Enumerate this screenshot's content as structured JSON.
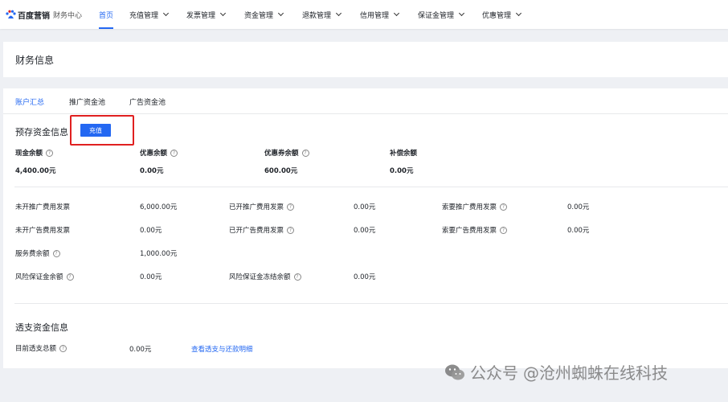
{
  "header": {
    "brand": "百度营销",
    "subtitle": "财务中心",
    "nav": [
      {
        "label": "首页",
        "active": true,
        "dropdown": false
      },
      {
        "label": "充值管理",
        "dropdown": true
      },
      {
        "label": "发票管理",
        "dropdown": true
      },
      {
        "label": "资金管理",
        "dropdown": true
      },
      {
        "label": "退款管理",
        "dropdown": true
      },
      {
        "label": "信用管理",
        "dropdown": true
      },
      {
        "label": "保证金管理",
        "dropdown": true
      },
      {
        "label": "优惠管理",
        "dropdown": true
      }
    ]
  },
  "page": {
    "title": "财务信息"
  },
  "tabs": [
    "账户汇总",
    "推广资金池",
    "广告资金池"
  ],
  "prepaid": {
    "title": "预存资金信息",
    "recharge_label": "充值",
    "balances": [
      {
        "label": "现金余额",
        "value": "4,400.00元"
      },
      {
        "label": "优惠余额",
        "value": "0.00元"
      },
      {
        "label": "优惠券余额",
        "value": "600.00元"
      },
      {
        "label": "补偿余额",
        "value": "0.00元"
      }
    ]
  },
  "invoice": {
    "row1": [
      {
        "label": "未开推广费用发票",
        "value": "6,000.00元"
      },
      {
        "label": "已开推广费用发票",
        "value": "0.00元"
      },
      {
        "label": "索要推广费用发票",
        "value": "0.00元"
      }
    ],
    "row2": [
      {
        "label": "未开广告费用发票",
        "value": "0.00元"
      },
      {
        "label": "已开广告费用发票",
        "value": "0.00元"
      },
      {
        "label": "索要广告费用发票",
        "value": "0.00元"
      }
    ],
    "service": {
      "label": "服务费余额",
      "value": "1,000.00元"
    },
    "risk": {
      "label": "风险保证金余额",
      "value": "0.00元"
    },
    "risk_frozen": {
      "label": "风险保证金冻结余额",
      "value": "0.00元"
    }
  },
  "overdraft": {
    "title": "透支资金信息",
    "label": "目前透支总额",
    "value": "0.00元",
    "link": "查看透支与还款明细"
  },
  "watermark": {
    "text": "公众号",
    "id": "@沧州蜘蛛在线科技"
  },
  "colors": {
    "accent": "#2468f2",
    "highlight": "#e02020"
  }
}
